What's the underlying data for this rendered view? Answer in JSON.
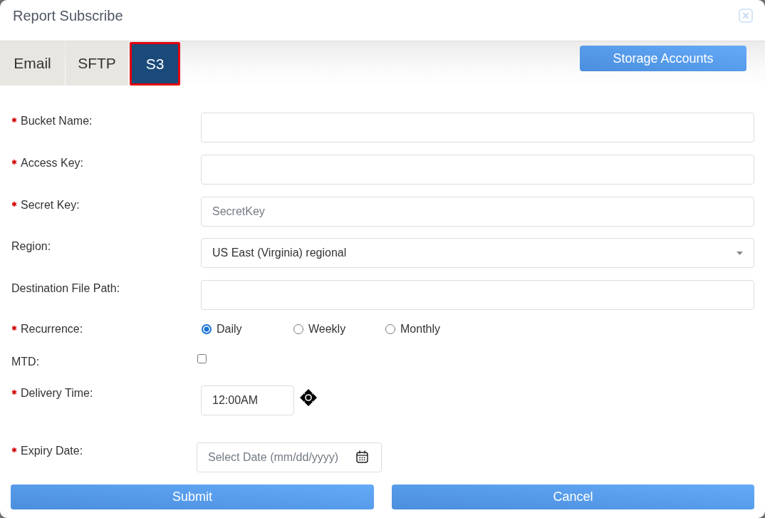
{
  "dialog": {
    "title": "Report Subscribe"
  },
  "tabs": [
    {
      "label": "Email",
      "selected": false
    },
    {
      "label": "SFTP",
      "selected": false
    },
    {
      "label": "S3",
      "selected": true
    }
  ],
  "action_button": {
    "label": "Storage Accounts"
  },
  "fields": [
    {
      "kind": "text",
      "label": "Bucket Name:",
      "required": true
    },
    {
      "kind": "text",
      "label": "Access Key:",
      "required": true
    },
    {
      "kind": "text",
      "label": "Secret Key:",
      "required": true,
      "placeholder": "SecretKey"
    },
    {
      "kind": "select",
      "label": "Region:",
      "required": false,
      "value": "US East (Virginia) regional"
    },
    {
      "kind": "text",
      "label": "Destination File Path:",
      "required": false
    },
    {
      "kind": "radio",
      "label": "Recurrence:",
      "required": true,
      "options": [
        {
          "label": "Daily",
          "selected": true
        },
        {
          "label": "Weekly",
          "selected": false
        },
        {
          "label": "Monthly",
          "selected": false
        }
      ]
    },
    {
      "kind": "checkbox",
      "label": "MTD:",
      "required": false,
      "checked": false
    },
    {
      "kind": "time",
      "label": "Delivery Time:",
      "required": true,
      "value": "12:00AM"
    },
    {
      "kind": "date",
      "label": "Expiry Date:",
      "required": true,
      "placeholder": "Select Date (mm/dd/yyyy)"
    }
  ],
  "buttons": [
    {
      "label": "Submit"
    },
    {
      "label": "Cancel"
    }
  ]
}
